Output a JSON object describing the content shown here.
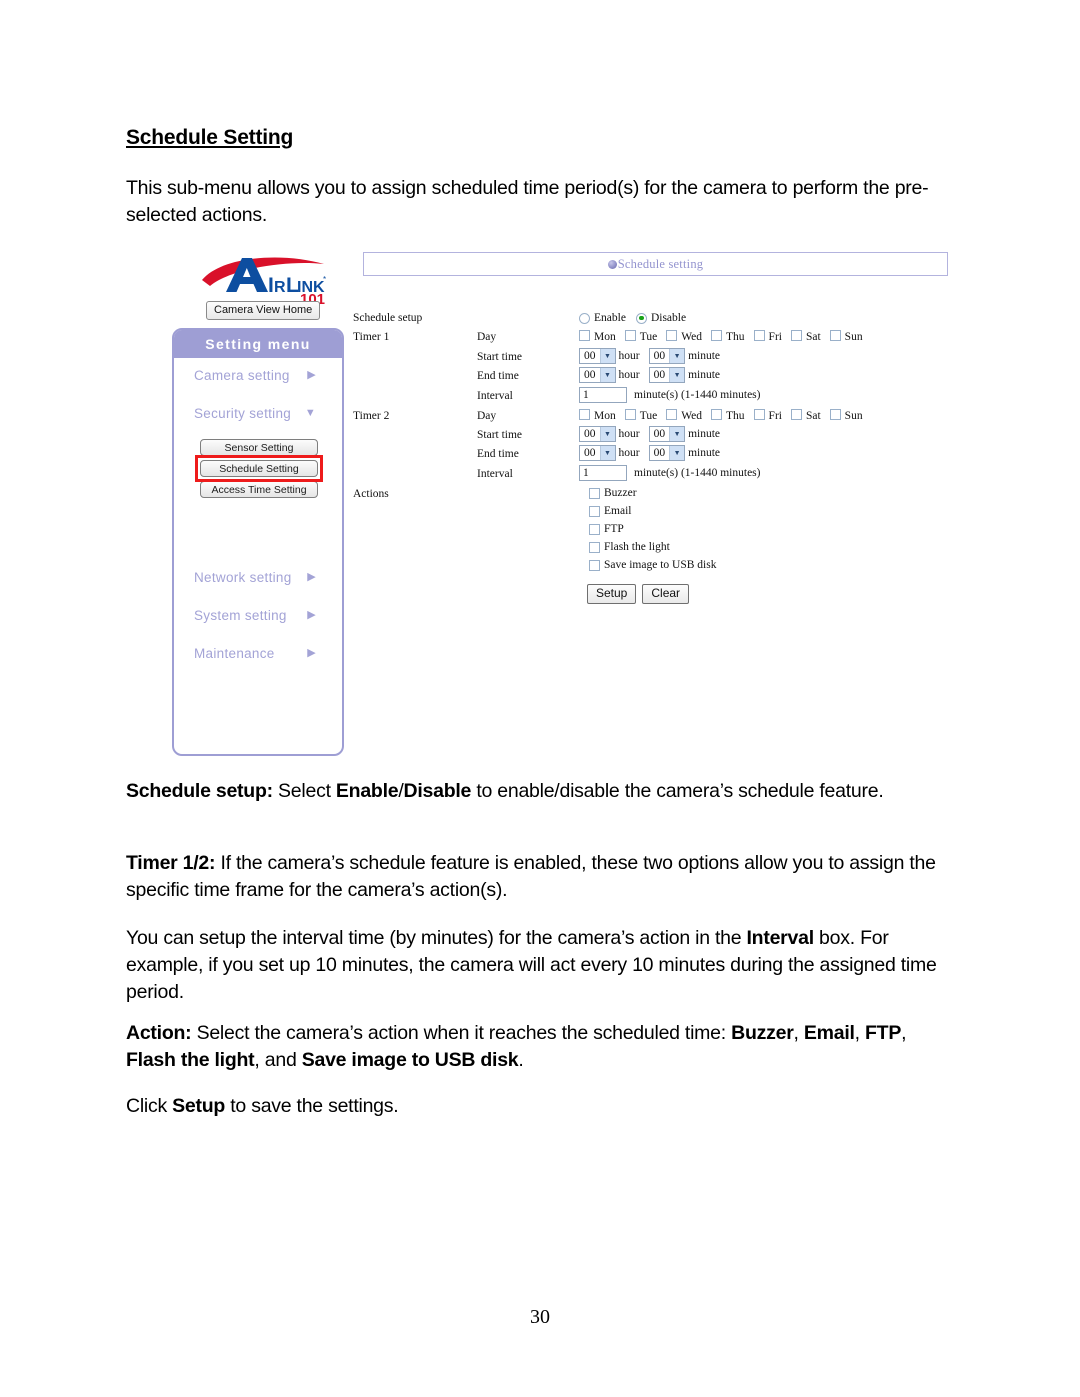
{
  "document": {
    "heading": "Schedule Setting",
    "intro": "This sub-menu allows you to assign scheduled time period(s) for the camera to perform the pre-selected actions.",
    "page_number": "30",
    "paragraphs": {
      "schedule_setup_label": "Schedule setup:",
      "schedule_setup_t1": " Select ",
      "schedule_setup_b1": "Enable",
      "schedule_setup_t2": "/",
      "schedule_setup_b2": "Disable",
      "schedule_setup_t3": " to enable/disable the camera’s schedule feature.",
      "timer_label": "Timer 1/2:",
      "timer_text": " If the camera’s schedule feature is enabled, these two options allow you to assign the specific time frame for the camera’s action(s).",
      "interval_t1": "You can setup the interval time (by minutes) for the camera’s action in the ",
      "interval_b1": "Interval",
      "interval_t2": " box. For example, if you set up 10 minutes, the camera will act every 10 minutes during the assigned time period.",
      "action_label": "Action:",
      "action_t1": " Select the camera’s action when it reaches the scheduled time: ",
      "action_b1": "Buzzer",
      "action_t2": ", ",
      "action_b2": "Email",
      "action_t3": ", ",
      "action_b3": "FTP",
      "action_t4": ", ",
      "action_b4": "Flash the light",
      "action_t5": ", and ",
      "action_b5": "Save image to USB disk",
      "action_t6": ".",
      "click_t1": "Click ",
      "click_b1": "Setup",
      "click_t2": " to save the settings."
    }
  },
  "screenshot": {
    "logo": {
      "brand_a": "A",
      "brand_ir": "IR",
      "brand_l": "L",
      "brand_ink": "INK",
      "brand_101": "101"
    },
    "camera_view_home_button": "Camera View Home",
    "sidebar": {
      "header": "Setting menu",
      "items": [
        {
          "label": "Camera setting",
          "arrow": "▶"
        },
        {
          "label": "Security setting",
          "arrow": "▼"
        },
        {
          "label": "Network setting",
          "arrow": "▶"
        },
        {
          "label": "System setting",
          "arrow": "▶"
        },
        {
          "label": "Maintenance",
          "arrow": "▶"
        }
      ],
      "sub_items": [
        {
          "label": "Sensor Setting",
          "selected": false
        },
        {
          "label": "Schedule Setting",
          "selected": true
        },
        {
          "label": "Access Time Setting",
          "selected": false
        }
      ],
      "highlight_color": "#ee1b1b",
      "header_color": "#9e9ed4"
    },
    "panel": {
      "title": "Schedule setting",
      "title_color": "#9494cf",
      "schedule_setup": {
        "label": "Schedule setup",
        "options": [
          "Enable",
          "Disable"
        ],
        "selected": "Disable"
      },
      "timers": [
        {
          "label": "Timer 1",
          "day_label": "Day",
          "days": [
            "Mon",
            "Tue",
            "Wed",
            "Thu",
            "Fri",
            "Sat",
            "Sun"
          ],
          "days_checked": [
            false,
            false,
            false,
            false,
            false,
            false,
            false
          ],
          "start_label": "Start time",
          "start_hour": "00",
          "start_minute": "00",
          "end_label": "End time",
          "end_hour": "00",
          "end_minute": "00",
          "hour_unit": "hour",
          "minute_unit": "minute",
          "interval_label": "Interval",
          "interval_value": "1",
          "interval_hint": "minute(s) (1-1440 minutes)"
        },
        {
          "label": "Timer 2",
          "day_label": "Day",
          "days": [
            "Mon",
            "Tue",
            "Wed",
            "Thu",
            "Fri",
            "Sat",
            "Sun"
          ],
          "days_checked": [
            false,
            false,
            false,
            false,
            false,
            false,
            false
          ],
          "start_label": "Start time",
          "start_hour": "00",
          "start_minute": "00",
          "end_label": "End time",
          "end_hour": "00",
          "end_minute": "00",
          "hour_unit": "hour",
          "minute_unit": "minute",
          "interval_label": "Interval",
          "interval_value": "1",
          "interval_hint": "minute(s) (1-1440 minutes)"
        }
      ],
      "actions": {
        "label": "Actions",
        "items": [
          {
            "label": "Buzzer",
            "checked": false
          },
          {
            "label": "Email",
            "checked": false
          },
          {
            "label": "FTP",
            "checked": false
          },
          {
            "label": "Flash the light",
            "checked": false
          },
          {
            "label": "Save image to USB disk",
            "checked": false
          }
        ]
      },
      "buttons": {
        "setup": "Setup",
        "clear": "Clear"
      }
    }
  }
}
